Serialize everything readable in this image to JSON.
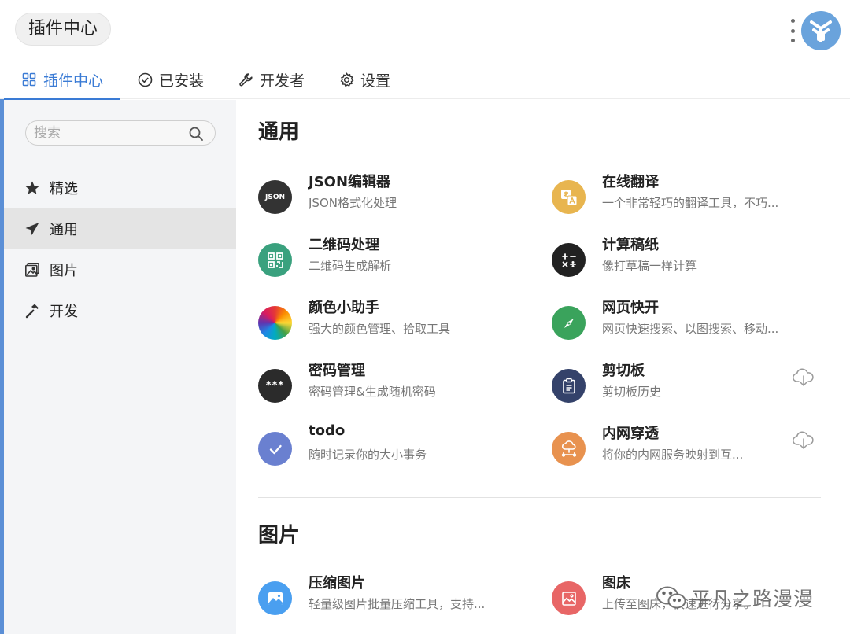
{
  "header": {
    "title": "插件中心",
    "tabs": [
      {
        "label": "插件中心",
        "icon": "grid-icon"
      },
      {
        "label": "已安装",
        "icon": "check-circle-icon"
      },
      {
        "label": "开发者",
        "icon": "wrench-icon"
      },
      {
        "label": "设置",
        "icon": "gear-icon"
      }
    ]
  },
  "sidebar": {
    "search_placeholder": "搜索",
    "items": [
      {
        "label": "精选",
        "icon": "star-icon"
      },
      {
        "label": "通用",
        "icon": "paper-plane-icon"
      },
      {
        "label": "图片",
        "icon": "image-icon"
      },
      {
        "label": "开发",
        "icon": "hammer-icon"
      }
    ]
  },
  "sections": [
    {
      "title": "通用",
      "plugins": [
        {
          "name": "JSON编辑器",
          "desc": "JSON格式化处理",
          "icon_text": "JSON",
          "color": "#333333"
        },
        {
          "name": "在线翻译",
          "desc": "一个非常轻巧的翻译工具，不巧...",
          "color": "#e8b54f"
        },
        {
          "name": "二维码处理",
          "desc": "二维码生成解析",
          "color": "#3aa17e"
        },
        {
          "name": "计算稿纸",
          "desc": "像打草稿一样计算",
          "color": "#222222"
        },
        {
          "name": "颜色小助手",
          "desc": "强大的颜色管理、拾取工具",
          "color": "rainbow"
        },
        {
          "name": "网页快开",
          "desc": "网页快速搜索、以图搜索、移动...",
          "color": "#3aa35c"
        },
        {
          "name": "密码管理",
          "desc": "密码管理&生成随机密码",
          "icon_text": "***",
          "color": "#2b2b2b"
        },
        {
          "name": "剪切板",
          "desc": "剪切板历史",
          "color": "#34426a"
        },
        {
          "name": "todo",
          "desc": "随时记录你的大小事务",
          "color": "#6a80d0"
        },
        {
          "name": "内网穿透",
          "desc": "将你的内网服务映射到互...",
          "color": "#e8924f"
        }
      ]
    },
    {
      "title": "图片",
      "plugins": [
        {
          "name": "压缩图片",
          "desc": "轻量级图片批量压缩工具，支持...",
          "color": "#4a9ff0"
        },
        {
          "name": "图床",
          "desc": "上传至图床，快速进行分享。",
          "color": "#e86666"
        }
      ]
    }
  ],
  "watermark": "平凡之路漫漫",
  "colors": {
    "accent": "#3a7bd5",
    "sidebar_bg": "#f4f5f7",
    "logo": "#6aa3dc"
  }
}
